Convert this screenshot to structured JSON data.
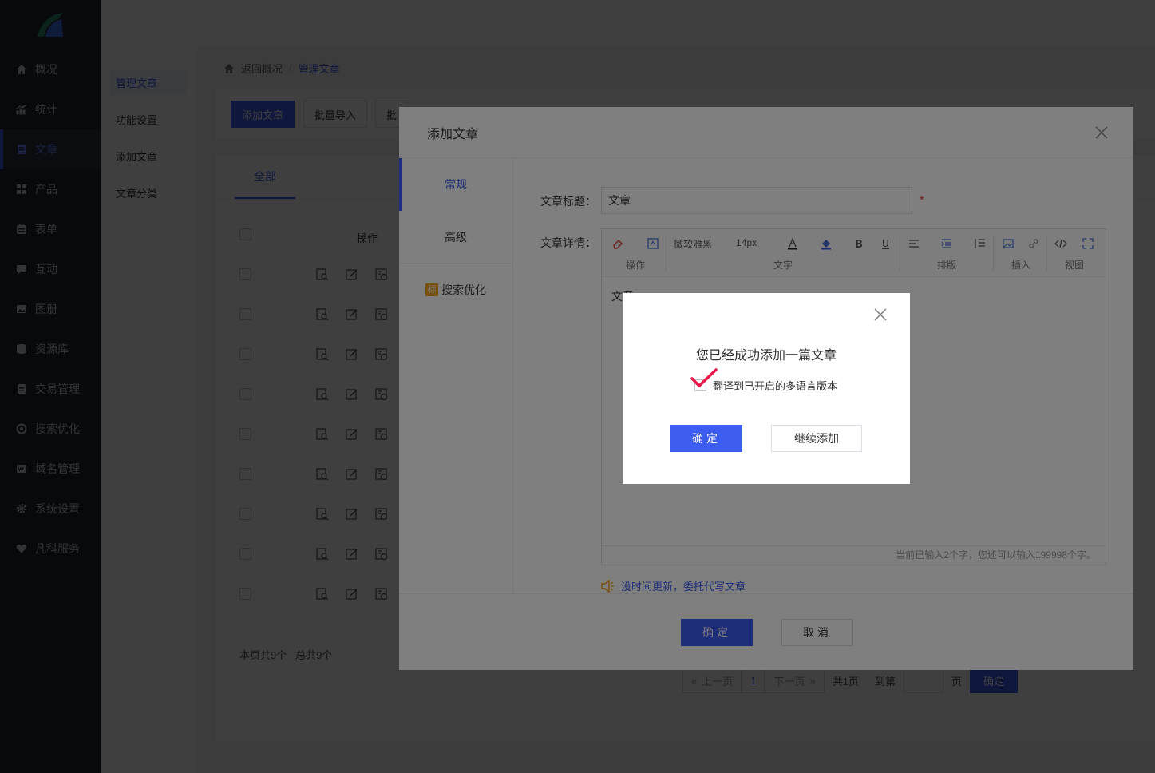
{
  "nav": {
    "items": [
      {
        "label": "概况",
        "icon": "home-icon"
      },
      {
        "label": "统计",
        "icon": "chart-icon"
      },
      {
        "label": "文章",
        "icon": "article-icon",
        "active": true
      },
      {
        "label": "产品",
        "icon": "grid-icon"
      },
      {
        "label": "表单",
        "icon": "form-icon"
      },
      {
        "label": "互动",
        "icon": "chat-icon"
      },
      {
        "label": "图册",
        "icon": "image-icon"
      },
      {
        "label": "资源库",
        "icon": "database-icon"
      },
      {
        "label": "交易管理",
        "icon": "trade-icon"
      },
      {
        "label": "搜索优化",
        "icon": "seo-icon"
      },
      {
        "label": "域名管理",
        "icon": "domain-icon"
      },
      {
        "label": "系统设置",
        "icon": "gear-icon"
      },
      {
        "label": "凡科服务",
        "icon": "heart-icon"
      }
    ]
  },
  "subnav": {
    "items": [
      "管理文章",
      "功能设置",
      "添加文章",
      "文章分类"
    ]
  },
  "breadcrumb": {
    "back": "返回概况",
    "sep": "/",
    "current": "管理文章"
  },
  "toolbar": {
    "add": "添加文章",
    "import": "批量导入",
    "batch": "批"
  },
  "list": {
    "tab_all": "全部",
    "op_header": "操作",
    "page_info": "本页共9个",
    "total_info": "总共9个"
  },
  "pager": {
    "prev": "上一页",
    "page": "1",
    "next": "下一页",
    "total": "共1页",
    "goto": "到第",
    "unit": "页",
    "confirm": "确定"
  },
  "modal": {
    "title": "添加文章",
    "tabs": [
      "常规",
      "高级",
      "搜索优化"
    ],
    "seo_tag": "标",
    "title_label": "文章标题：",
    "title_value": "文章",
    "required": "*",
    "detail_label": "文章详情：",
    "editor": {
      "font": "微软雅黑",
      "size": "14px",
      "group_labels": [
        "操作",
        "文字",
        "排版",
        "插入",
        "视图"
      ],
      "content": "文章",
      "count_text": "当前已输入2个字，您还可以输入199998个字。"
    },
    "ghost_link": "没时间更新，委托代写文章",
    "ok": "确定",
    "cancel": "取消"
  },
  "dialog": {
    "title": "您已经成功添加一篇文章",
    "checkbox_label": "翻译到已开启的多语言版本",
    "ok": "确定",
    "continue": "继续添加"
  },
  "colors": {
    "accent": "#3d5cf0",
    "nav_bg": "#1f2530",
    "check": "#e8194a"
  }
}
